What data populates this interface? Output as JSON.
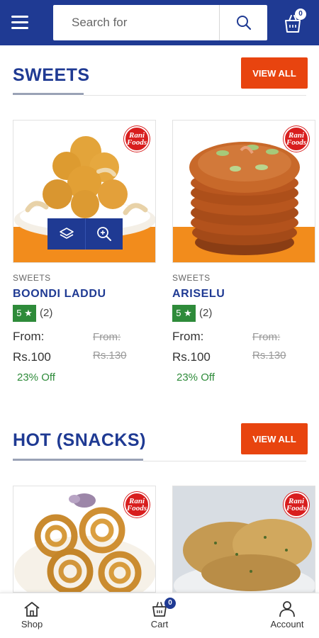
{
  "header": {
    "search_placeholder": "Search for",
    "cart_count": "0"
  },
  "brand_badge": "Rani Foods",
  "sections": [
    {
      "title": "SWEETS",
      "view_all": "VIEW ALL",
      "products": [
        {
          "category": "SWEETS",
          "name": "BOONDI LADDU",
          "rating": "5 ★",
          "reviews": "(2)",
          "from_label": "From:",
          "price": "Rs.100",
          "old_from": "From:",
          "old_price": "Rs.130",
          "discount": "23% Off"
        },
        {
          "category": "SWEETS",
          "name": "ARISELU",
          "rating": "5 ★",
          "reviews": "(2)",
          "from_label": "From:",
          "price": "Rs.100",
          "old_from": "From:",
          "old_price": "Rs.130",
          "discount": "23% Off"
        }
      ]
    },
    {
      "title": "HOT (SNACKS)",
      "view_all": "VIEW ALL"
    }
  ],
  "bottom_nav": {
    "items": [
      {
        "label": "Shop",
        "icon": "home-icon"
      },
      {
        "label": "Cart",
        "icon": "cart-icon"
      },
      {
        "label": "Account",
        "icon": "user-icon"
      }
    ],
    "cart_count": "0"
  },
  "colors": {
    "primary": "#1f3a93",
    "accent": "#e8440f",
    "rating": "#2e8b3a"
  }
}
